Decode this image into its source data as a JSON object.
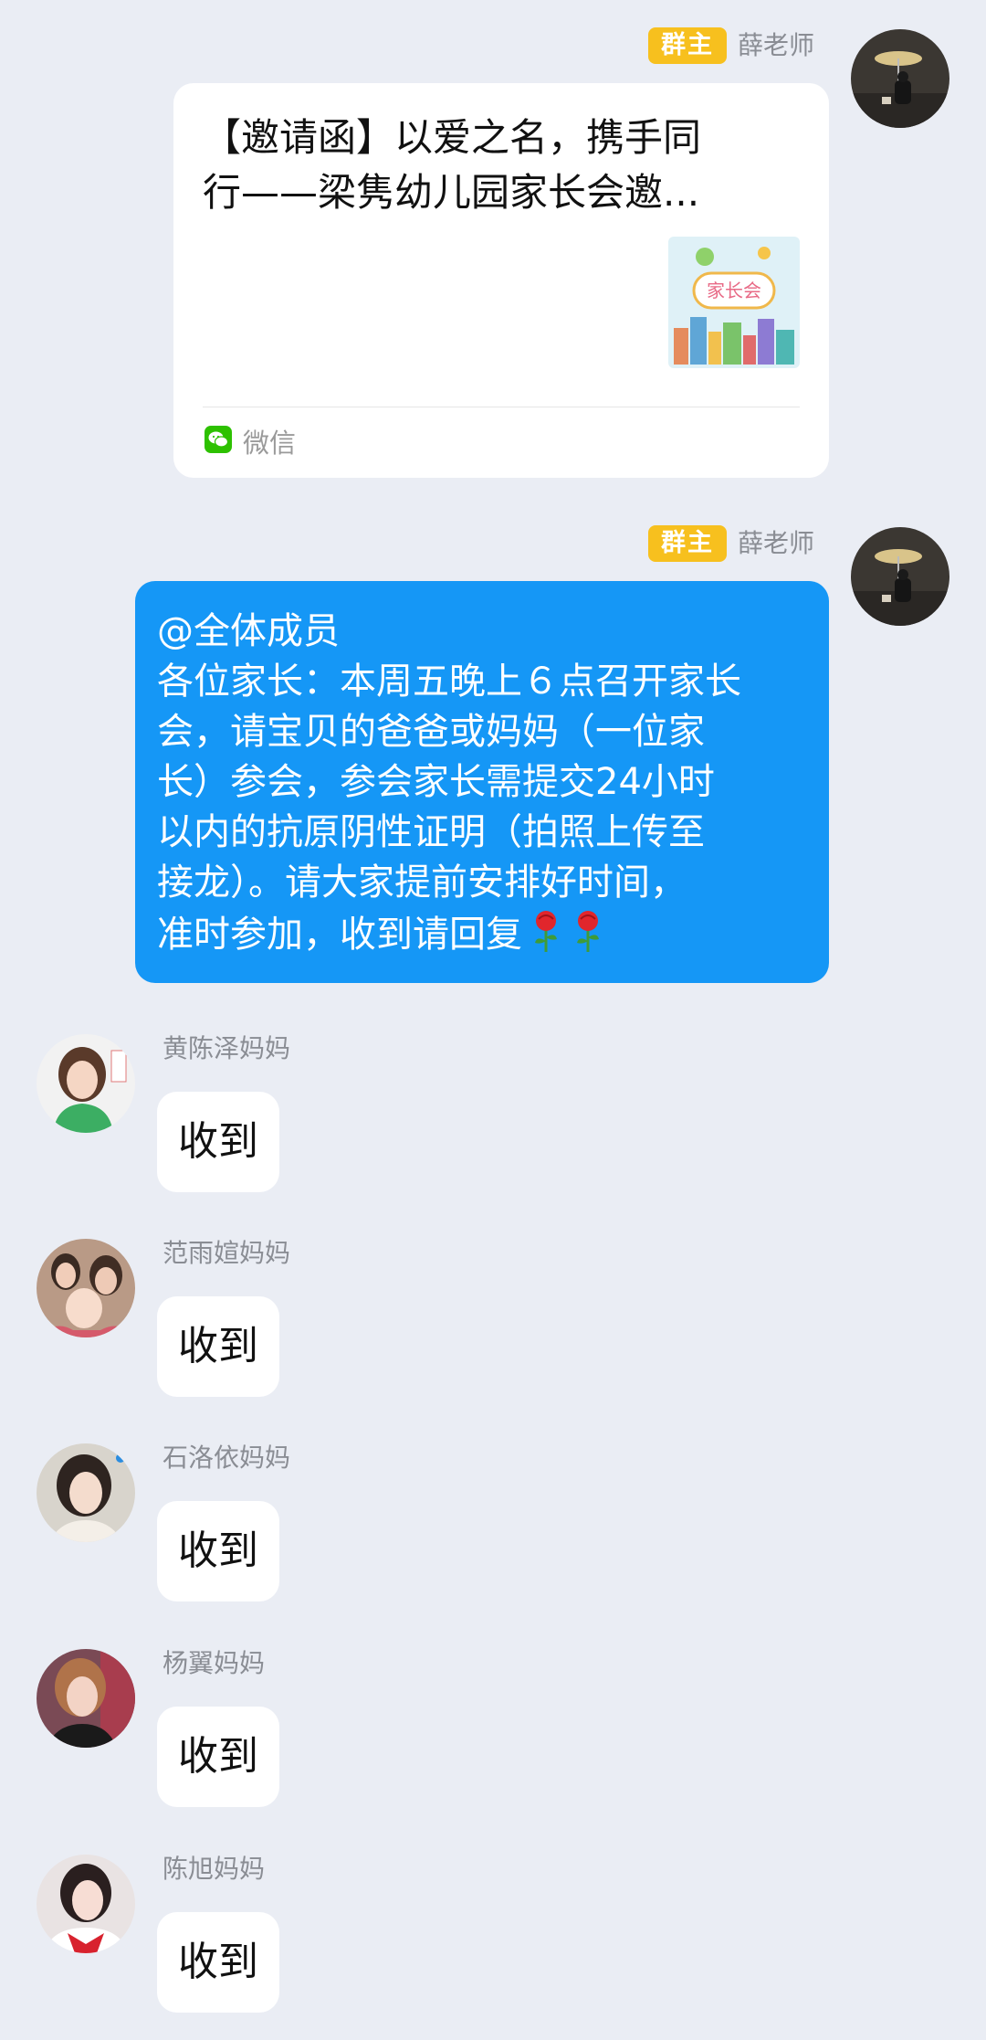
{
  "messages": [
    {
      "sender": "薛老师",
      "role": "群主",
      "card": {
        "title_line1": "【邀请函】以爱之名，携手同",
        "title_line2": "行——梁隽幼儿园家长会邀...",
        "thumb_text": "家长会",
        "source": "微信"
      }
    },
    {
      "sender": "薛老师",
      "role": "群主",
      "text_lines": [
        "@全体成员",
        "各位家长：本周五晚上６点召开家长",
        "会，请宝贝的爸爸或妈妈（一位家",
        "长）参会，参会家长需提交24小时",
        "以内的抗原阴性证明（拍照上传至",
        "接龙）。请大家提前安排好时间，",
        "准时参加，收到请回复"
      ]
    }
  ],
  "replies": [
    {
      "sender": "黄陈泽妈妈",
      "text": "收到"
    },
    {
      "sender": "范雨媗妈妈",
      "text": "收到"
    },
    {
      "sender": "石洛依妈妈",
      "text": "收到"
    },
    {
      "sender": "杨翼妈妈",
      "text": "收到"
    },
    {
      "sender": "陈旭妈妈",
      "text": "收到"
    }
  ],
  "icons": {
    "wechat": "wechat-icon",
    "flower": "rose-emoji"
  },
  "colors": {
    "background": "#eaedf4",
    "bubble_blue": "#1597f6",
    "badge_yellow": "#f7c01e",
    "wechat_green": "#2dc100"
  }
}
